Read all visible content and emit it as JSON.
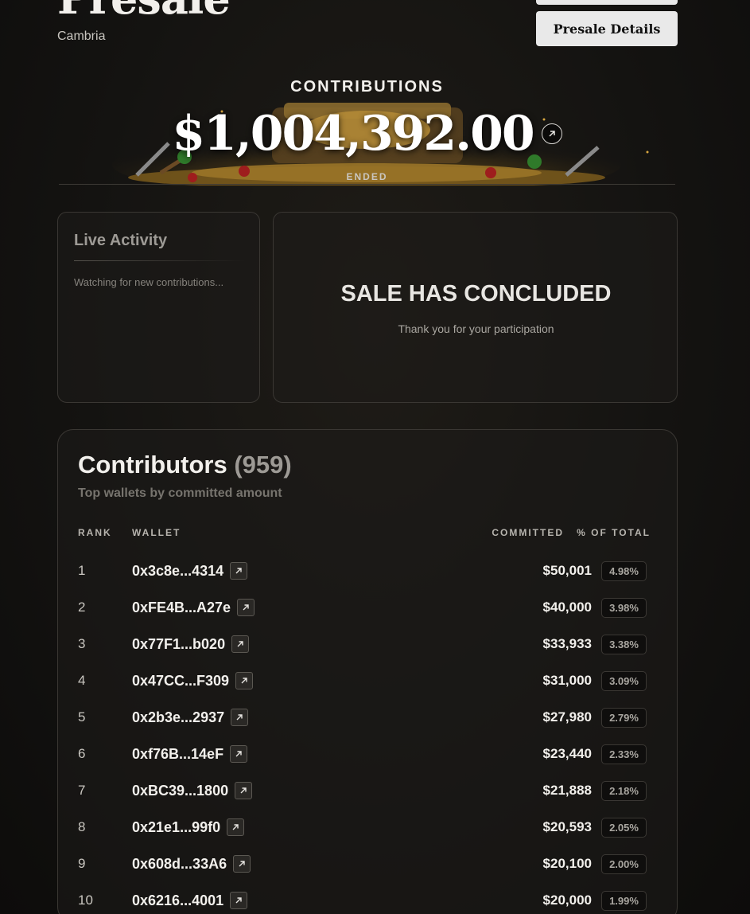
{
  "header": {
    "title": "Presale",
    "project": "Cambria",
    "details_button": "Presale Details"
  },
  "hero": {
    "label": "CONTRIBUTIONS",
    "amount": "$1,004,392.00",
    "status": "ENDED"
  },
  "live_activity": {
    "title": "Live Activity",
    "message": "Watching for new contributions..."
  },
  "sale_status": {
    "title": "SALE HAS CONCLUDED",
    "message": "Thank you for your participation"
  },
  "contributors": {
    "title": "Contributors",
    "count": "(959)",
    "subtitle": "Top wallets by committed amount",
    "columns": {
      "rank": "RANK",
      "wallet": "WALLET",
      "committed": "COMMITTED",
      "percent": "% OF TOTAL"
    },
    "rows": [
      {
        "rank": "1",
        "wallet": "0x3c8e...4314",
        "committed": "$50,001",
        "percent": "4.98%"
      },
      {
        "rank": "2",
        "wallet": "0xFE4B...A27e",
        "committed": "$40,000",
        "percent": "3.98%"
      },
      {
        "rank": "3",
        "wallet": "0x77F1...b020",
        "committed": "$33,933",
        "percent": "3.38%"
      },
      {
        "rank": "4",
        "wallet": "0x47CC...F309",
        "committed": "$31,000",
        "percent": "3.09%"
      },
      {
        "rank": "5",
        "wallet": "0x2b3e...2937",
        "committed": "$27,980",
        "percent": "2.79%"
      },
      {
        "rank": "6",
        "wallet": "0xf76B...14eF",
        "committed": "$23,440",
        "percent": "2.33%"
      },
      {
        "rank": "7",
        "wallet": "0xBC39...1800",
        "committed": "$21,888",
        "percent": "2.18%"
      },
      {
        "rank": "8",
        "wallet": "0x21e1...99f0",
        "committed": "$20,593",
        "percent": "2.05%"
      },
      {
        "rank": "9",
        "wallet": "0x608d...33A6",
        "committed": "$20,100",
        "percent": "2.00%"
      },
      {
        "rank": "10",
        "wallet": "0x6216...4001",
        "committed": "$20,000",
        "percent": "1.99%"
      }
    ]
  },
  "icons": {
    "external_link": "arrow-up-right-icon"
  }
}
